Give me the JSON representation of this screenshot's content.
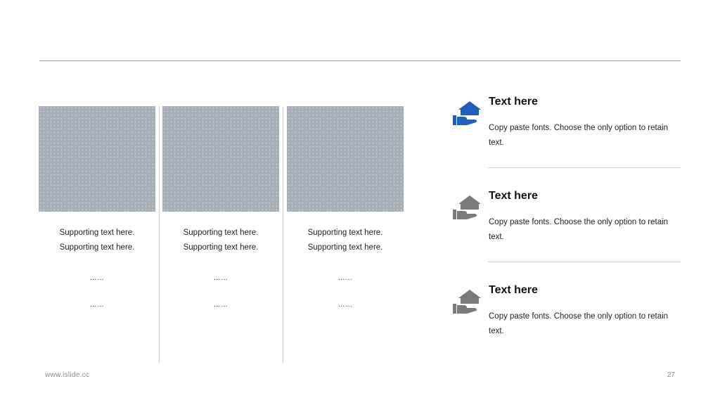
{
  "columns": [
    {
      "image": "image-placeholder",
      "lines": [
        "Supporting text here.",
        "Supporting text here."
      ],
      "dots": [
        "……",
        "……"
      ]
    },
    {
      "image": "image-placeholder",
      "lines": [
        "Supporting text here.",
        "Supporting text here."
      ],
      "dots": [
        "……",
        "……"
      ]
    },
    {
      "image": "image-placeholder",
      "lines": [
        "Supporting text here.",
        "Supporting text here."
      ],
      "dots": [
        "……",
        "……"
      ]
    }
  ],
  "features": [
    {
      "icon": "hand-graduation-cap-icon",
      "icon_color": "#1f5fbf",
      "title": "Text here",
      "description": "Copy paste fonts. Choose the only option to retain text."
    },
    {
      "icon": "hand-graduation-cap-icon",
      "icon_color": "#7a7a7a",
      "title": "Text here",
      "description": "Copy paste fonts. Choose the only option to retain text."
    },
    {
      "icon": "hand-graduation-cap-icon",
      "icon_color": "#7a7a7a",
      "title": "Text here",
      "description": "Copy paste fonts. Choose the only option to retain text."
    }
  ],
  "footer": {
    "url": "www.islide.cc",
    "page_number": "27"
  }
}
